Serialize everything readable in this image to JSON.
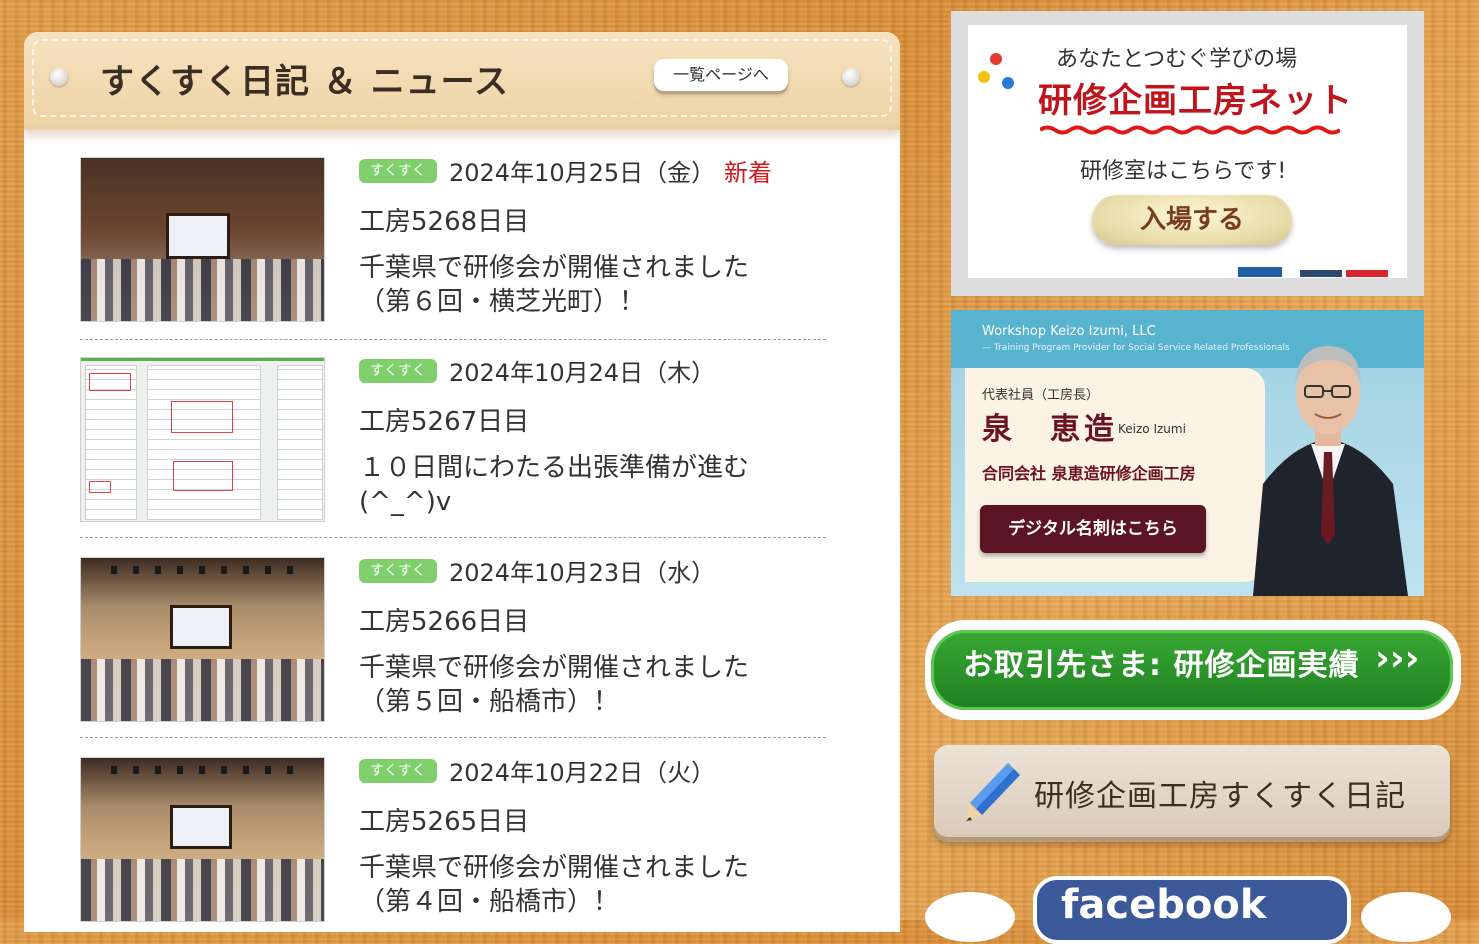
{
  "news": {
    "title": "すくすく日記 ＆ ニュース",
    "list_button": "一覧ページへ",
    "entries": [
      {
        "tag": "すくすく",
        "date": "2024年10月25日（金）",
        "new_label": "新着",
        "day": "工房5268日目",
        "body": "千葉県で研修会が開催されました（第６回・横芝光町）！"
      },
      {
        "tag": "すくすく",
        "date": "2024年10月24日（木）",
        "day": "工房5267日目",
        "body": "１０日間にわたる出張準備が進む(^_^)v"
      },
      {
        "tag": "すくすく",
        "date": "2024年10月23日（水）",
        "day": "工房5266日目",
        "body": "千葉県で研修会が開催されました（第５回・船橋市）！"
      },
      {
        "tag": "すくすく",
        "date": "2024年10月22日（火）",
        "day": "工房5265日目",
        "body": "千葉県で研修会が開催されました（第４回・船橋市）！"
      }
    ]
  },
  "sidebar": {
    "net_banner": {
      "subtitle": "あなたとつむぐ学びの場",
      "title": "研修企画工房ネット",
      "room_text": "研修室はこちらです!",
      "enter_label": "入場する"
    },
    "profile_banner": {
      "company_en": "Workshop Keizo Izumi, LLC",
      "tagline_en": "— Training Program Provider for Social Service Related Professionals",
      "role": "代表社員（工房長）",
      "name": "泉　恵造",
      "name_en": "Keizo Izumi",
      "company": "合同会社 泉恵造研修企画工房",
      "card_button": "デジタル名刺はこちら"
    },
    "clients_button": {
      "label": "お取引先さま: 研修企画実績",
      "arrows": "›››"
    },
    "diary_button": {
      "label": "研修企画工房すくすく日記"
    },
    "facebook": {
      "label": "facebook"
    }
  }
}
